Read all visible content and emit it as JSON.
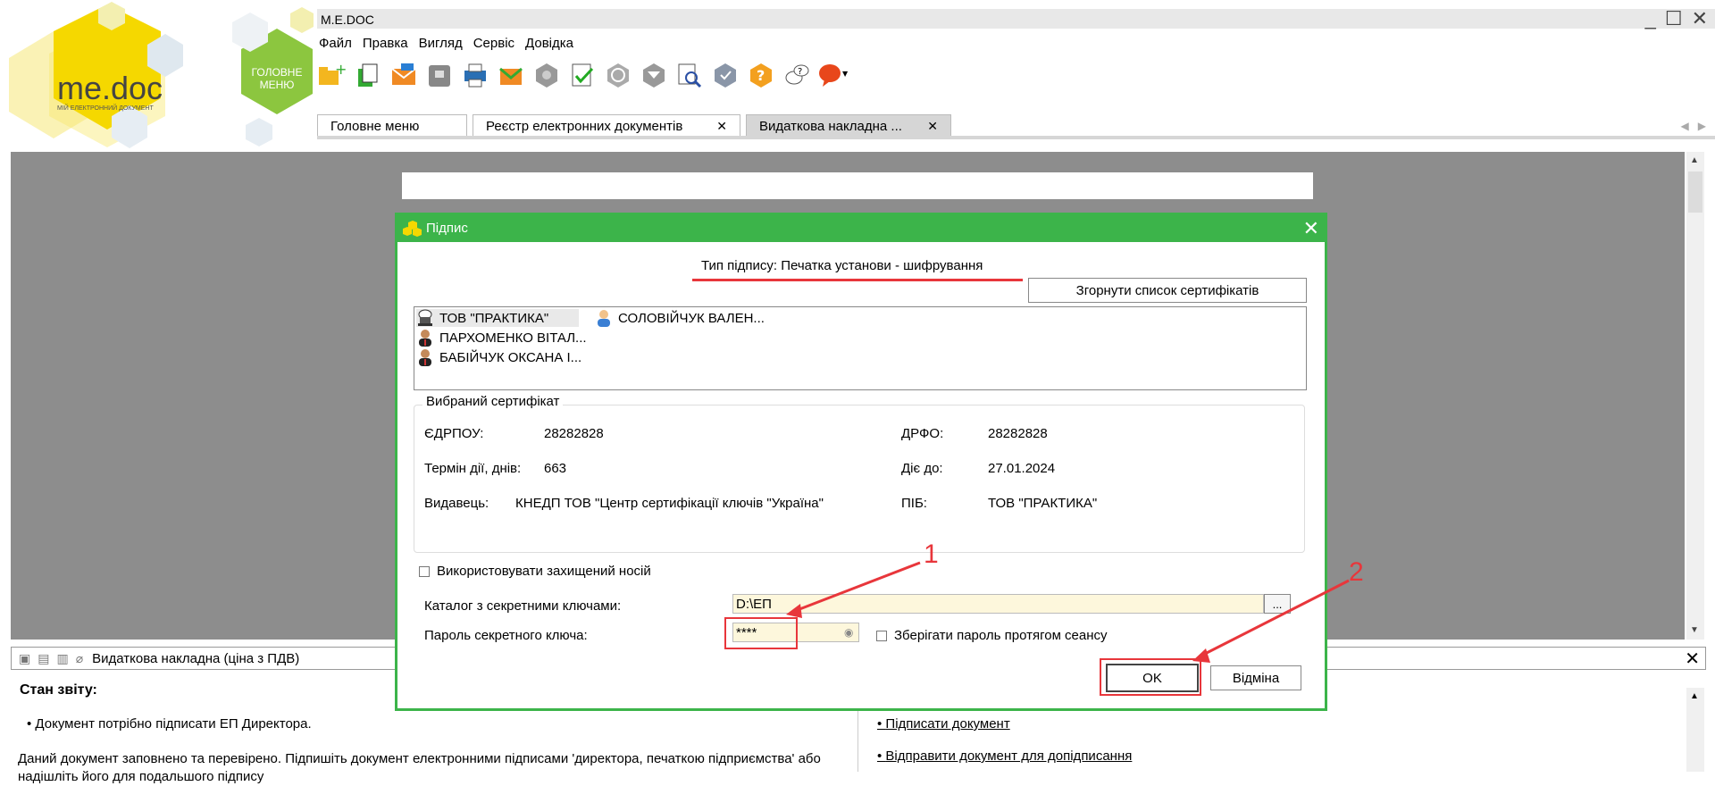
{
  "logo": {
    "brand": "me.doc",
    "tagline": "МІЙ ЕЛЕКТРОННИЙ ДОКУМЕНТ",
    "main_menu_label": "ГОЛОВНЕ МЕНЮ"
  },
  "window": {
    "title": "M.E.DOC",
    "minimize": "_",
    "maximize": "☐",
    "close": "✕"
  },
  "menu": [
    "Файл",
    "Правка",
    "Вигляд",
    "Сервіс",
    "Довідка"
  ],
  "toolbar_icons": [
    "new-document-icon",
    "copy-icon",
    "send-icon",
    "archive-icon",
    "print-icon",
    "export-icon",
    "search-key-icon",
    "checklist-icon",
    "refresh-icon",
    "filter-icon",
    "preview-icon",
    "shield-icon",
    "help-icon",
    "chat-icon",
    "feedback-icon"
  ],
  "tabs": [
    {
      "label": "Головне меню",
      "closable": false,
      "active": false
    },
    {
      "label": "Реєстр електронних документів",
      "closable": true,
      "active": false
    },
    {
      "label": "Видаткова накладна ...",
      "closable": true,
      "active": true
    }
  ],
  "tab_close": "✕",
  "tab_nav": {
    "prev": "◀",
    "next": "▶"
  },
  "scroll": {
    "up": "▲",
    "down": "▼"
  },
  "dialog": {
    "title": "Підпис",
    "close": "✕",
    "signature_type": "Тип підпису: Печатка установи - шифрування",
    "collapse_button": "Згорнути список сертифікатів",
    "certificates": [
      {
        "name": "ТОВ \"ПРАКТИКА\"",
        "icon": "stamp-icon",
        "selected": true
      },
      {
        "name": "СОЛОВІЙЧУК ВАЛЕН...",
        "icon": "person-icon",
        "selected": false
      },
      {
        "name": "ПАРХОМЕНКО ВІТАЛ...",
        "icon": "person-icon",
        "selected": false
      },
      {
        "name": "БАБІЙЧУК ОКСАНА І...",
        "icon": "person-icon",
        "selected": false
      }
    ],
    "selected_cert": {
      "title": "Вибраний сертифікат",
      "edrpou_label": "ЄДРПОУ:",
      "edrpou": "28282828",
      "drfo_label": "ДРФО:",
      "drfo": "28282828",
      "validity_label": "Термін дії, днів:",
      "validity": "663",
      "valid_until_label": "Діє до:",
      "valid_until": "27.01.2024",
      "issuer_label": "Видавець:",
      "issuer": "КНЕДП ТОВ \"Центр сертифікації ключів \"Україна\"",
      "pib_label": "ПІБ:",
      "pib": "ТОВ \"ПРАКТИКА\""
    },
    "use_protected_media": "Використовувати захищений носій",
    "keys_dir_label": "Каталог з секретними ключами:",
    "keys_dir_value": "D:\\ЕП",
    "browse": "...",
    "password_label": "Пароль секретного ключа:",
    "password_value": "****",
    "save_password": "Зберігати пароль протягом сеансу",
    "ok": "OK",
    "cancel": "Відміна"
  },
  "annotations": {
    "one": "1",
    "two": "2"
  },
  "bottom": {
    "doc_title": "Видаткова накладна (ціна з ПДВ)",
    "close": "✕",
    "status_title": "Стан звіту:",
    "bullet": "Документ потрібно підписати ЕП Директора.",
    "text": "Даний документ заповнено та перевірено. Підпишіть документ електронними підписами 'директора, печаткою підприємства' або надішліть його для подальшого підпису",
    "link_sign": "Підписати документ",
    "link_send": "Відправити документ для допідписання"
  },
  "colors": {
    "accent_green": "#3cb44a",
    "annotation_red": "#e8363b",
    "logo_yellow": "#f5d800",
    "logo_green": "#8cc63f"
  }
}
